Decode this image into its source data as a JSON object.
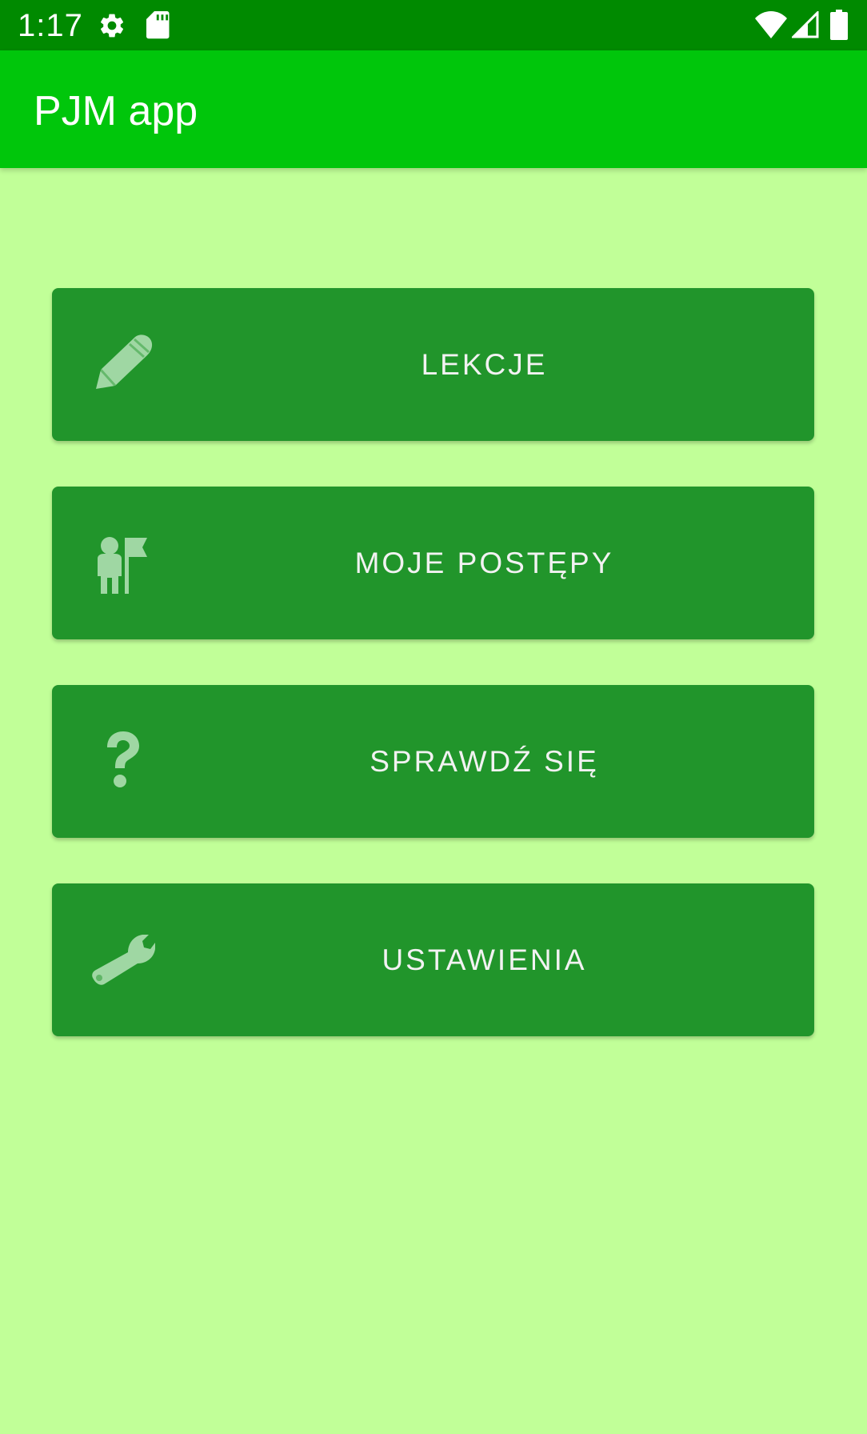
{
  "status_bar": {
    "time": "1:17",
    "icons": [
      "gear-icon",
      "sd-card-icon",
      "wifi-icon",
      "cellular-signal-icon",
      "battery-icon"
    ]
  },
  "app_bar": {
    "title": "PJM app"
  },
  "menu": {
    "items": [
      {
        "label": "LEKCJE",
        "icon": "pencil-icon"
      },
      {
        "label": "MOJE POSTĘPY",
        "icon": "person-flag-icon"
      },
      {
        "label": "SPRAWDŹ SIĘ",
        "icon": "question-mark-icon"
      },
      {
        "label": "USTAWIENIA",
        "icon": "wrench-icon"
      }
    ]
  },
  "colors": {
    "status_bar": "#008a00",
    "app_bar": "#00c60b",
    "background": "#c1ff98",
    "button": "#21952b",
    "button_icon": "#9fd7a3",
    "button_text": "#f2f2f2"
  }
}
